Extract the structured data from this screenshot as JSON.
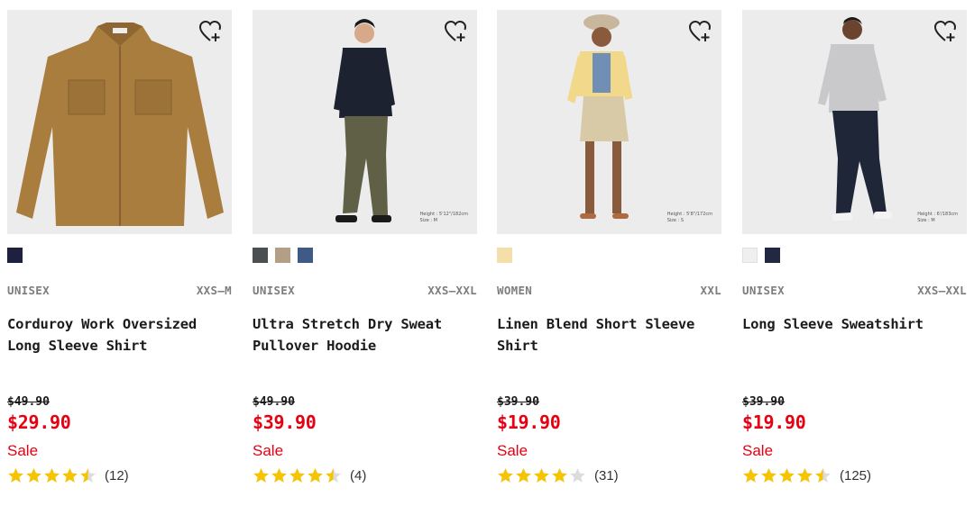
{
  "colors": {
    "sale_red": "#e60012",
    "star_gold": "#f6c400",
    "star_empty": "#dcdcdc",
    "photo_bg": "#ececec"
  },
  "products": [
    {
      "gender": "UNISEX",
      "size_range": "XXS–M",
      "name_line1": "Corduroy Work Oversized",
      "name_line2": "Long Sleeve Shirt",
      "original_price": "$49.90",
      "sale_price": "$29.90",
      "sale_label": "Sale",
      "rating": 4.5,
      "review_count": "(12)",
      "swatches": [
        "#1e2040"
      ],
      "image_caption_line1": "",
      "image_caption_line2": "",
      "wishlist_icon": "heart-plus-icon"
    },
    {
      "gender": "UNISEX",
      "size_range": "XXS–XXL",
      "name_line1": "Ultra Stretch Dry Sweat",
      "name_line2": "Pullover Hoodie",
      "original_price": "$49.90",
      "sale_price": "$39.90",
      "sale_label": "Sale",
      "rating": 4.5,
      "review_count": "(4)",
      "swatches": [
        "#4a4f52",
        "#b39e86",
        "#3f5a86"
      ],
      "image_caption_line1": "Height : 5'12\"/182cm",
      "image_caption_line2": "Size : M",
      "wishlist_icon": "heart-plus-icon"
    },
    {
      "gender": "WOMEN",
      "size_range": "XXL",
      "name_line1": "Linen Blend Short Sleeve",
      "name_line2": "Shirt",
      "original_price": "$39.90",
      "sale_price": "$19.90",
      "sale_label": "Sale",
      "rating": 4,
      "review_count": "(31)",
      "swatches": [
        "#f5dfa8"
      ],
      "image_caption_line1": "Height : 5'8\"/172cm",
      "image_caption_line2": "Size : S",
      "wishlist_icon": "heart-plus-icon"
    },
    {
      "gender": "UNISEX",
      "size_range": "XXS–XXL",
      "name_line1": "Long Sleeve Sweatshirt",
      "name_line2": "",
      "original_price": "$39.90",
      "sale_price": "$19.90",
      "sale_label": "Sale",
      "rating": 4.5,
      "review_count": "(125)",
      "swatches": [
        "#efefef",
        "#232842"
      ],
      "image_caption_line1": "Height : 6'/183cm",
      "image_caption_line2": "Size : M",
      "wishlist_icon": "heart-plus-icon"
    }
  ]
}
